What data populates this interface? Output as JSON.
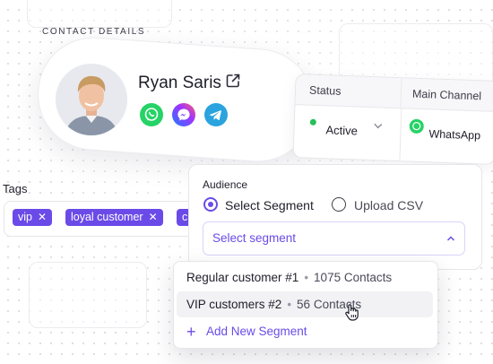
{
  "contact": {
    "section_label": "CONTACT DETAILS",
    "name": "Ryan Saris",
    "channels": [
      "whatsapp-icon",
      "messenger-icon",
      "telegram-icon"
    ]
  },
  "table": {
    "headers": [
      "Status",
      "Main Channel"
    ],
    "status": "Active",
    "channel": "WhatsApp"
  },
  "tags": {
    "label": "Tags",
    "items": [
      {
        "label": "vip"
      },
      {
        "label": "loyal customer"
      },
      {
        "label": "c"
      }
    ]
  },
  "audience": {
    "title": "Audience",
    "options": [
      "Select Segment",
      "Upload CSV"
    ],
    "selected_option": "Select Segment",
    "select_placeholder": "Select segment"
  },
  "segments": {
    "items": [
      {
        "name": "Regular customer #1",
        "contacts": "1075 Contacts"
      },
      {
        "name": "VIP customers #2",
        "contacts": "56 Contacts"
      }
    ],
    "add_label": "Add New Segment"
  },
  "colors": {
    "accent": "#6a4be8",
    "success": "#25c05a",
    "whatsapp": "#25d366",
    "telegram": "#2aa3de"
  }
}
